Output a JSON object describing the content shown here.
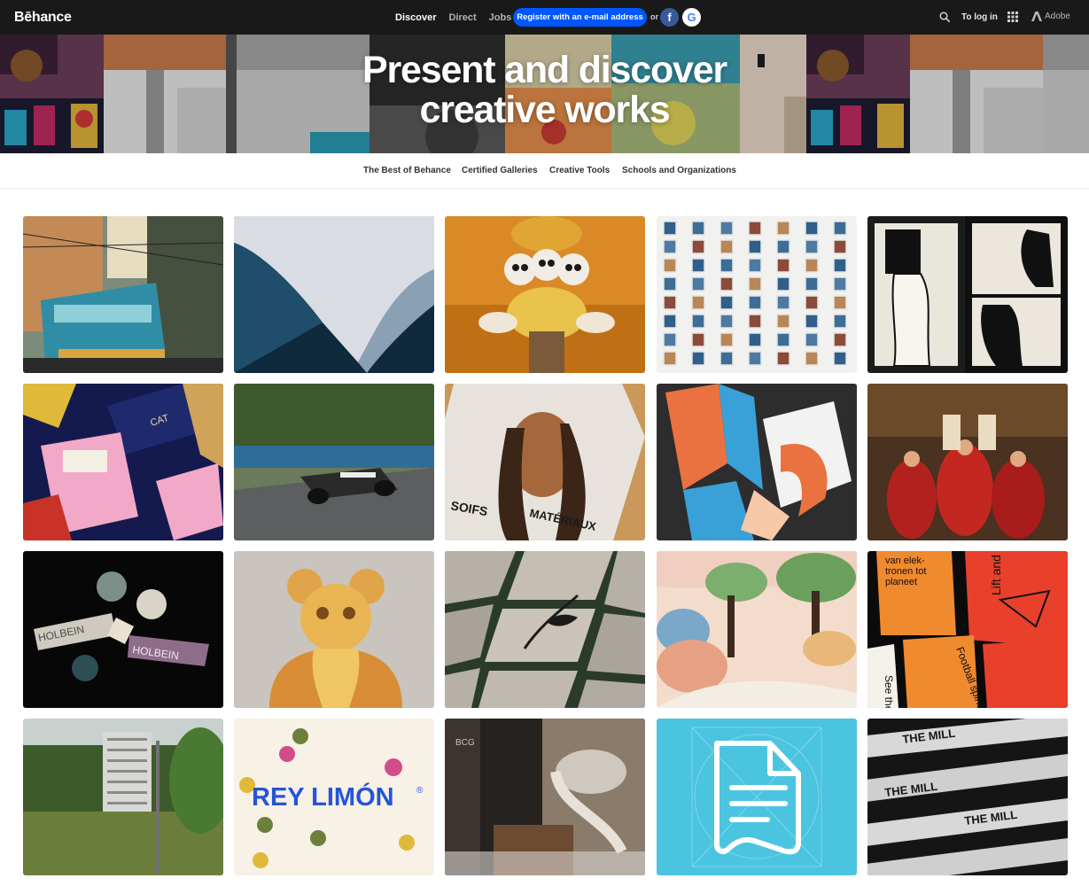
{
  "header": {
    "logo": "Bēhance",
    "nav": [
      "Discover",
      "Direct",
      "Jobs"
    ],
    "register_label": "Register with an e-mail address",
    "or_label": "or",
    "facebook_glyph": "f",
    "google_glyph": "G",
    "login_label": "To log in",
    "adobe_label": "Adobe",
    "icons": [
      "search-icon",
      "app-grid-icon",
      "adobe-logo-icon"
    ]
  },
  "hero": {
    "title_line1": "Present and discover",
    "title_line2": "creative works"
  },
  "subnav": [
    "The Best of Behance",
    "Certified Galleries",
    "Creative Tools",
    "Schools and Organizations"
  ],
  "cards": {
    "matchbox_cat": "CAT",
    "holbein_label": "HOLBEIN",
    "poster_1": "van elek-\ntronen tot\nplaneet",
    "poster_2": "Lift and write",
    "poster_3": "Football spirit & precision",
    "poster_4": "See the",
    "rey_limon": "REY LIMÓN",
    "rey_limon_mark": "®",
    "magazine_1": "SOIFS",
    "magazine_2": "MATÉRIAUX",
    "mill_text": "THE MILL",
    "bcg_sign": "BCG"
  },
  "colors": {
    "topbar": "#191919",
    "accent": "#0057ff",
    "facebook": "#3b5998"
  }
}
